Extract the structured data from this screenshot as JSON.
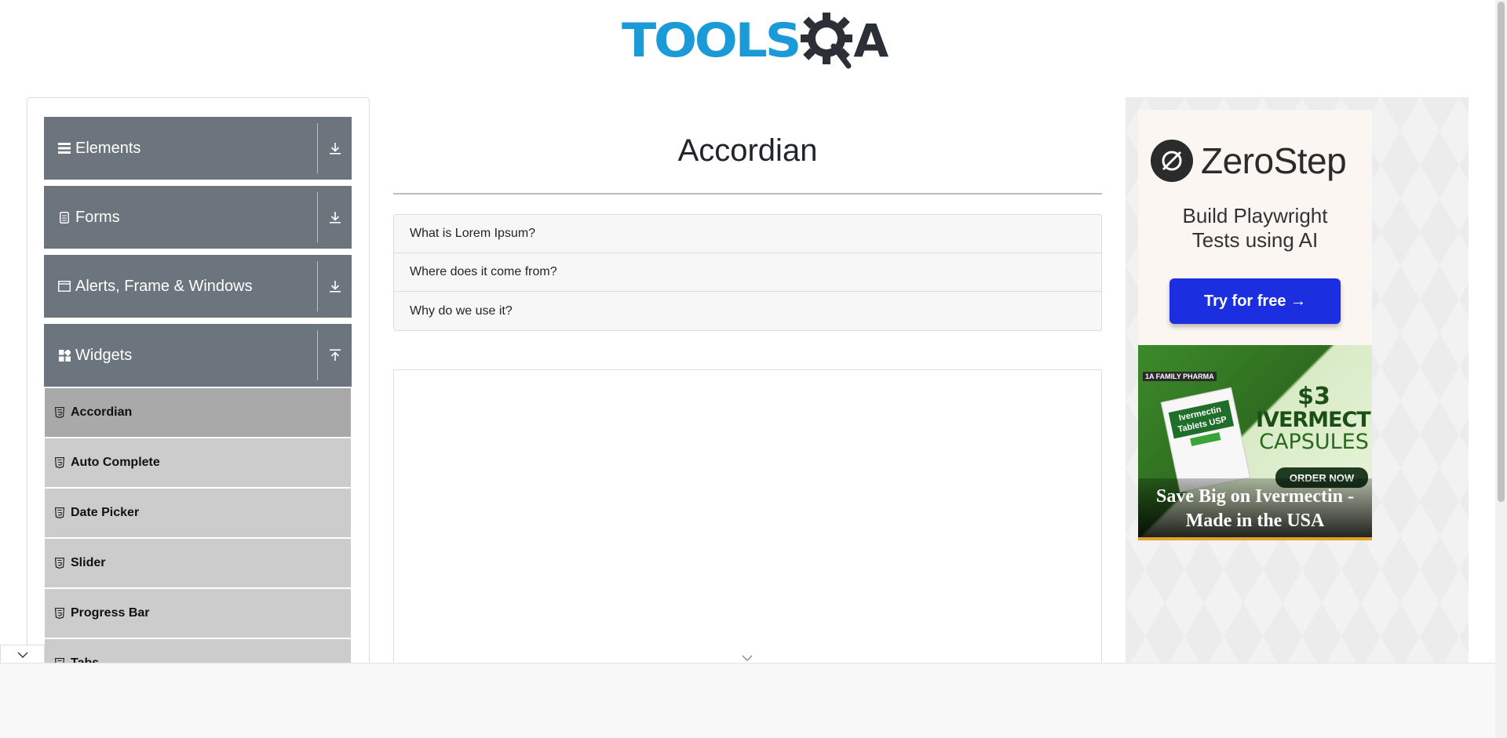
{
  "header": {
    "logo_text_left": "TOOLS",
    "logo_text_right": "A"
  },
  "sidebar": {
    "groups": [
      {
        "label": "Elements",
        "icon": "hamburger-icon",
        "arrow": "download-icon"
      },
      {
        "label": "Forms",
        "icon": "form-icon",
        "arrow": "download-icon"
      },
      {
        "label": "Alerts, Frame & Windows",
        "icon": "window-icon",
        "arrow": "download-icon"
      },
      {
        "label": "Widgets",
        "icon": "widgets-icon",
        "arrow": "upload-icon"
      }
    ],
    "widget_items": [
      {
        "label": "Accordian",
        "active": true
      },
      {
        "label": "Auto Complete",
        "active": false
      },
      {
        "label": "Date Picker",
        "active": false
      },
      {
        "label": "Slider",
        "active": false
      },
      {
        "label": "Progress Bar",
        "active": false
      },
      {
        "label": "Tabs",
        "active": false
      }
    ]
  },
  "main": {
    "title": "Accordian",
    "accordion": [
      "What is Lorem Ipsum?",
      "Where does it come from?",
      "Why do we use it?"
    ]
  },
  "ads": {
    "zerostep": {
      "brand": "ZeroStep",
      "tagline_1": "Build Playwright",
      "tagline_2": "Tests using AI",
      "cta": "Try for free →"
    },
    "pharma": {
      "brand": "1A FAMILY PHARMA",
      "box_text_1": "Ivermectin",
      "box_text_2": "Tablets USP",
      "price": "$3",
      "product_1": "IVERMECTIN",
      "product_2": "CAPSULES",
      "order": "ORDER NOW",
      "headline_1": "Save Big on Ivermectin -",
      "headline_2": "Made in the USA"
    }
  },
  "colors": {
    "accent_blue": "#1a9ad6",
    "sidebar_header": "#6c757d",
    "sidebar_item": "#cccccc",
    "sidebar_item_active": "#a9a9a9",
    "cta_blue": "#1b2fe0"
  }
}
